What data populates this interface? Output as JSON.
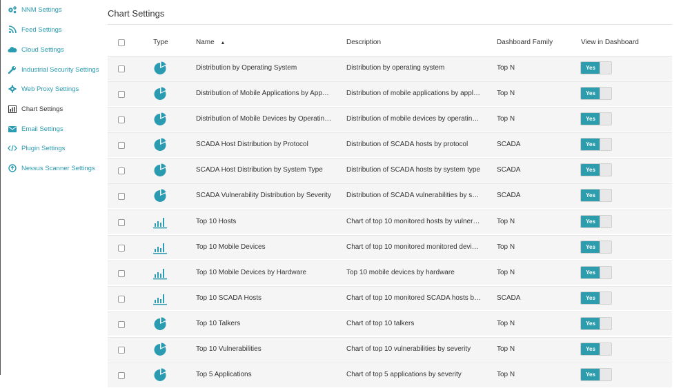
{
  "sidebar": {
    "items": [
      {
        "label": "NNM Settings",
        "icon": "gears-icon",
        "active": false
      },
      {
        "label": "Feed Settings",
        "icon": "rss-icon",
        "active": false
      },
      {
        "label": "Cloud Settings",
        "icon": "cloud-icon",
        "active": false
      },
      {
        "label": "Industrial Security Settings",
        "icon": "wrench-icon",
        "active": false
      },
      {
        "label": "Web Proxy Settings",
        "icon": "gear-icon",
        "active": false
      },
      {
        "label": "Chart Settings",
        "icon": "bar-chart-icon",
        "active": true
      },
      {
        "label": "Email Settings",
        "icon": "envelope-icon",
        "active": false
      },
      {
        "label": "Plugin Settings",
        "icon": "code-icon",
        "active": false
      },
      {
        "label": "Nessus Scanner Settings",
        "icon": "arrow-circle-icon",
        "active": false
      }
    ]
  },
  "page": {
    "title": "Chart Settings"
  },
  "table": {
    "headers": {
      "type": "Type",
      "name": "Name",
      "sort_indicator": "▲",
      "description": "Description",
      "family": "Dashboard Family",
      "view": "View in Dashboard"
    },
    "rows": [
      {
        "type": "pie",
        "name": "Distribution by Operating System",
        "description": "Distribution by operating system",
        "family": "Top N",
        "toggle": "Yes"
      },
      {
        "type": "pie",
        "name": "Distribution of Mobile Applications by App…",
        "description": "Distribution of mobile applications by appl…",
        "family": "Top N",
        "toggle": "Yes"
      },
      {
        "type": "pie",
        "name": "Distribution of Mobile Devices by Operatin…",
        "description": "Distribution of mobile devices by operatin…",
        "family": "Top N",
        "toggle": "Yes"
      },
      {
        "type": "pie",
        "name": "SCADA Host Distribution by Protocol",
        "description": "Distribution of SCADA hosts by protocol",
        "family": "SCADA",
        "toggle": "Yes"
      },
      {
        "type": "pie",
        "name": "SCADA Host Distribution by System Type",
        "description": "Distribution of SCADA hosts by system type",
        "family": "SCADA",
        "toggle": "Yes"
      },
      {
        "type": "pie",
        "name": "SCADA Vulnerability Distribution by Severity",
        "description": "Distribution of SCADA vulnerabilities by s…",
        "family": "SCADA",
        "toggle": "Yes"
      },
      {
        "type": "bar",
        "name": "Top 10 Hosts",
        "description": "Chart of top 10 monitored hosts by vulner…",
        "family": "Top N",
        "toggle": "Yes"
      },
      {
        "type": "bar",
        "name": "Top 10 Mobile Devices",
        "description": "Chart of top 10 monitored monitored devi…",
        "family": "Top N",
        "toggle": "Yes"
      },
      {
        "type": "bar",
        "name": "Top 10 Mobile Devices by Hardware",
        "description": "Top 10 mobile devices by hardware",
        "family": "Top N",
        "toggle": "Yes"
      },
      {
        "type": "bar",
        "name": "Top 10 SCADA Hosts",
        "description": "Chart of top 10 monitored SCADA hosts b…",
        "family": "SCADA",
        "toggle": "Yes"
      },
      {
        "type": "pie",
        "name": "Top 10 Talkers",
        "description": "Chart of top 10 talkers",
        "family": "Top N",
        "toggle": "Yes"
      },
      {
        "type": "pie",
        "name": "Top 10 Vulnerabilities",
        "description": "Chart of top 10 vulnerabilities by severity",
        "family": "Top N",
        "toggle": "Yes"
      },
      {
        "type": "pie",
        "name": "Top 5 Applications",
        "description": "Chart of top 5 applications by severity",
        "family": "Top N",
        "toggle": "Yes"
      }
    ]
  },
  "colors": {
    "accent": "#2a9bb0",
    "toggle_on": "#2d9dae",
    "row_bg": "#f5f5f5"
  }
}
